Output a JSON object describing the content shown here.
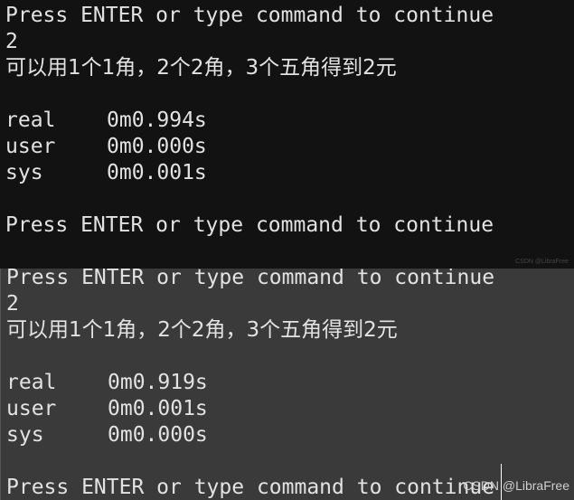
{
  "top_pane": {
    "prompt_1": "Press ENTER or type command to continue",
    "input": "2",
    "result": "可以用1个1角，2个2角，3个五角得到2元",
    "timing": [
      {
        "label": "real",
        "value": "0m0.994s"
      },
      {
        "label": "user",
        "value": "0m0.000s"
      },
      {
        "label": "sys",
        "value": "0m0.001s"
      }
    ],
    "prompt_2": "Press ENTER or type command to continue",
    "watermark": "CSDN @LibraFree"
  },
  "bottom_pane": {
    "prompt_1": "Press ENTER or type command to continue",
    "input": "2",
    "result": "可以用1个1角，2个2角，3个五角得到2元",
    "timing": [
      {
        "label": "real",
        "value": "0m0.919s"
      },
      {
        "label": "user",
        "value": "0m0.001s"
      },
      {
        "label": "sys",
        "value": "0m0.000s"
      }
    ],
    "prompt_2": "Press ENTER or type command to continue",
    "watermark": "CSDN @LibraFree"
  },
  "colors": {
    "top_bg": "#121212",
    "bottom_bg": "#3a3a3a",
    "text": "#e2e2e2"
  }
}
